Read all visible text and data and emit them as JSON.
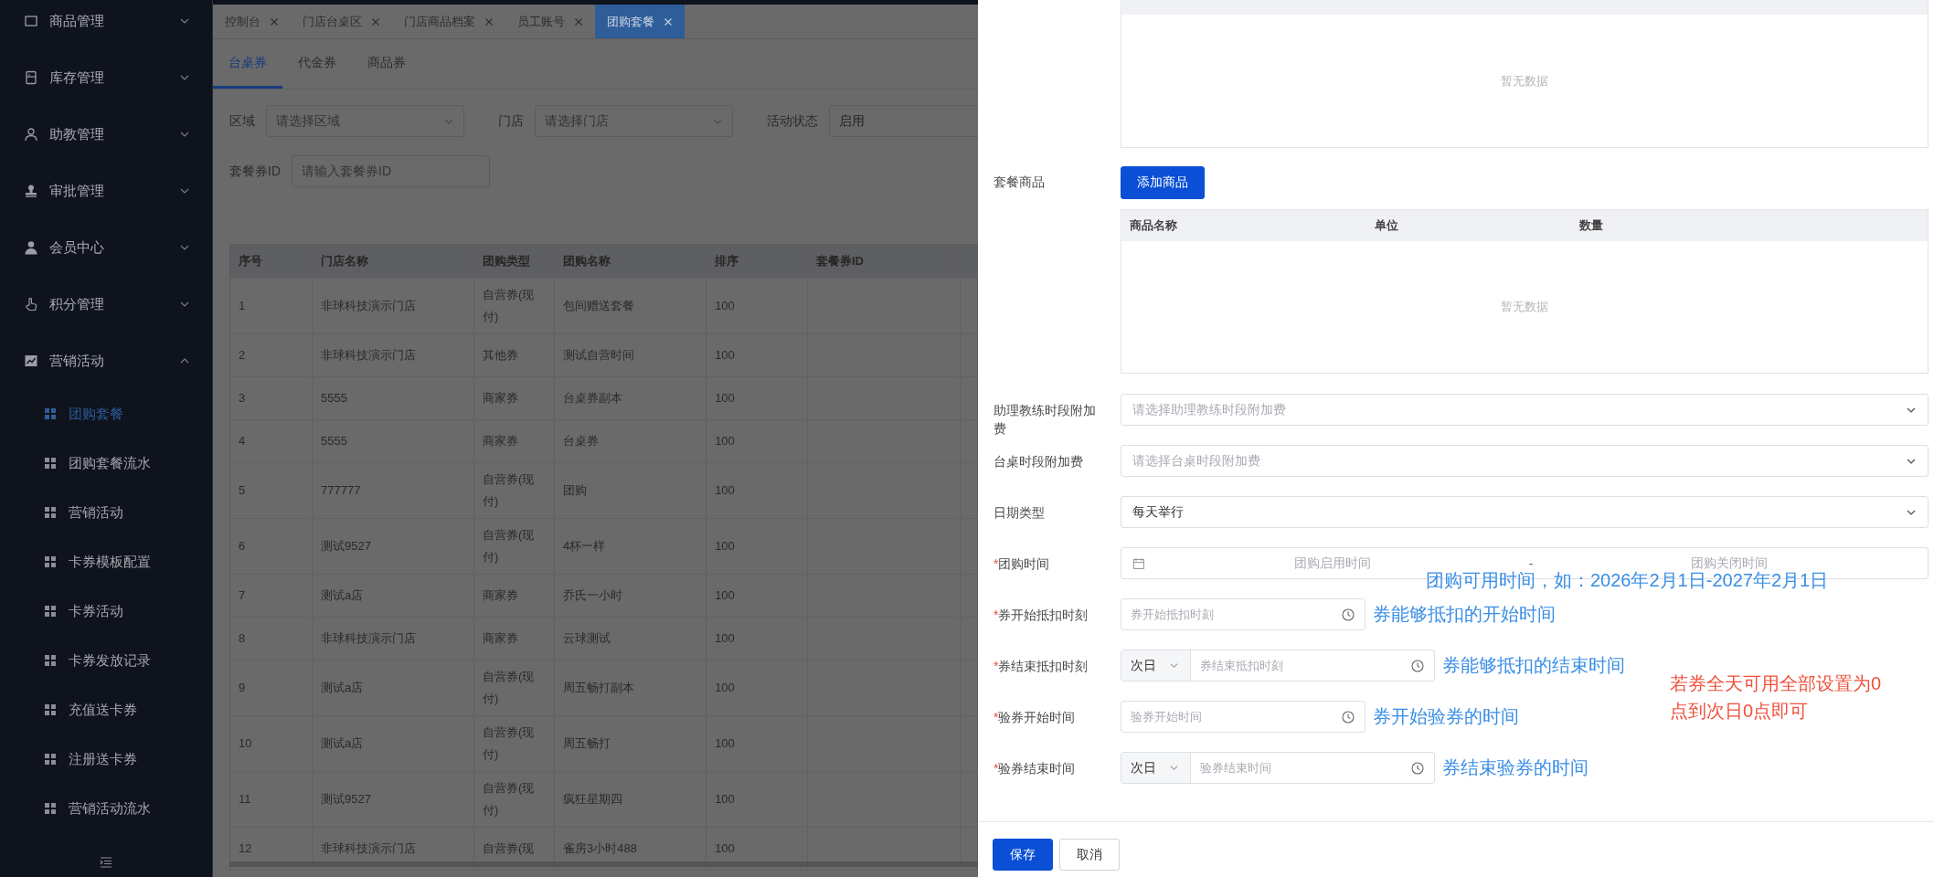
{
  "sidebar": {
    "menus": [
      {
        "label": "商品管理",
        "expanded": false
      },
      {
        "label": "库存管理",
        "expanded": false
      },
      {
        "label": "助教管理",
        "expanded": false
      },
      {
        "label": "审批管理",
        "expanded": false
      },
      {
        "label": "会员中心",
        "expanded": false
      },
      {
        "label": "积分管理",
        "expanded": false
      },
      {
        "label": "营销活动",
        "expanded": true,
        "children": [
          {
            "label": "团购套餐",
            "selected": true
          },
          {
            "label": "团购套餐流水",
            "selected": false
          },
          {
            "label": "营销活动",
            "selected": false
          },
          {
            "label": "卡券模板配置",
            "selected": false
          },
          {
            "label": "卡券活动",
            "selected": false
          },
          {
            "label": "卡券发放记录",
            "selected": false
          },
          {
            "label": "充值送卡券",
            "selected": false
          },
          {
            "label": "注册送卡券",
            "selected": false
          },
          {
            "label": "营销活动流水",
            "selected": false
          }
        ]
      }
    ]
  },
  "tabs": [
    {
      "label": "控制台",
      "selected": false
    },
    {
      "label": "门店台桌区",
      "selected": false
    },
    {
      "label": "门店商品档案",
      "selected": false
    },
    {
      "label": "员工账号",
      "selected": false
    },
    {
      "label": "团购套餐",
      "selected": true
    }
  ],
  "sub_tabs": [
    {
      "label": "台桌券",
      "selected": true
    },
    {
      "label": "代金券",
      "selected": false
    },
    {
      "label": "商品券",
      "selected": false
    }
  ],
  "filters": [
    {
      "kind": "select",
      "label": "区域",
      "placeholder": "请选择区域"
    },
    {
      "kind": "select",
      "label": "门店",
      "placeholder": "请选择门店"
    },
    {
      "kind": "select",
      "label": "活动状态",
      "value": "启用"
    },
    {
      "kind": "input",
      "label": "套餐券ID",
      "placeholder": "请输入套餐券ID"
    }
  ],
  "table": {
    "columns": [
      "序号",
      "门店名称",
      "团购类型",
      "团购名称",
      "排序",
      "套餐券ID"
    ],
    "rows": [
      [
        "1",
        "非球科技演示门店",
        "自营券(现付)",
        "包间赠送套餐",
        "100",
        ""
      ],
      [
        "2",
        "非球科技演示门店",
        "其他券",
        "测试自营时间",
        "100",
        ""
      ],
      [
        "3",
        "5555",
        "商家券",
        "台桌券副本",
        "100",
        ""
      ],
      [
        "4",
        "5555",
        "商家券",
        "台桌券",
        "100",
        ""
      ],
      [
        "5",
        "777777",
        "自营券(现付)",
        "团购",
        "100",
        ""
      ],
      [
        "6",
        "测试9527",
        "自营券(现付)",
        "4杯一样",
        "100",
        ""
      ],
      [
        "7",
        "测试a店",
        "商家券",
        "乔氏一小时",
        "100",
        ""
      ],
      [
        "8",
        "非球科技演示门店",
        "商家券",
        "云球测试",
        "100",
        ""
      ],
      [
        "9",
        "测试a店",
        "自营券(现付)",
        "周五畅打副本",
        "100",
        ""
      ],
      [
        "10",
        "测试a店",
        "自营券(现付)",
        "周五畅打",
        "100",
        ""
      ],
      [
        "11",
        "测试9527",
        "自营券(现付)",
        "疯狂星期四",
        "100",
        ""
      ],
      [
        "12",
        "非球科技演示门店",
        "自营券(现",
        "雀房3小时488",
        "100",
        ""
      ]
    ]
  },
  "drawer": {
    "top_table": {
      "empty_text": "暂无数据"
    },
    "package_goods": {
      "label": "套餐商品",
      "button": "添加商品",
      "columns": [
        "商品名称",
        "单位",
        "数量"
      ],
      "empty_text": "暂无数据"
    },
    "fields": [
      {
        "kind": "select",
        "label": "助理教练时段附加费",
        "placeholder": "请选择助理教练时段附加费"
      },
      {
        "kind": "select",
        "label": "台桌时段附加费",
        "placeholder": "请选择台桌时段附加费"
      },
      {
        "kind": "select",
        "label": "日期类型",
        "value": "每天举行"
      },
      {
        "kind": "daterange",
        "mark": "*",
        "label": "团购时间",
        "start_placeholder": "团购启用时间",
        "separator": "-",
        "end_placeholder": "团购关闭时间",
        "note": "团购可用时间，如：2026年2月1日-2027年2月1日"
      },
      {
        "kind": "time",
        "mark": "*",
        "label": "券开始抵扣时刻",
        "placeholder": "券开始抵扣时刻",
        "note": "券能够抵扣的开始时间"
      },
      {
        "kind": "daytime",
        "mark": "*",
        "label": "券结束抵扣时刻",
        "prefix": "次日",
        "placeholder": "券结束抵扣时刻",
        "note": "券能够抵扣的结束时间"
      },
      {
        "kind": "time",
        "mark": "*",
        "label": "验券开始时间",
        "placeholder": "验券开始时间",
        "note": "券开始验券的时间"
      },
      {
        "kind": "daytime",
        "mark": "*",
        "label": "验券结束时间",
        "prefix": "次日",
        "placeholder": "验券结束时间",
        "note": "券结束验券的时间"
      }
    ],
    "tip": "若券全天可用全部设置为0点到次日0点即可",
    "buttons": [
      {
        "kind": "primary",
        "label": "保存"
      },
      {
        "kind": "default",
        "label": "取消"
      }
    ]
  }
}
